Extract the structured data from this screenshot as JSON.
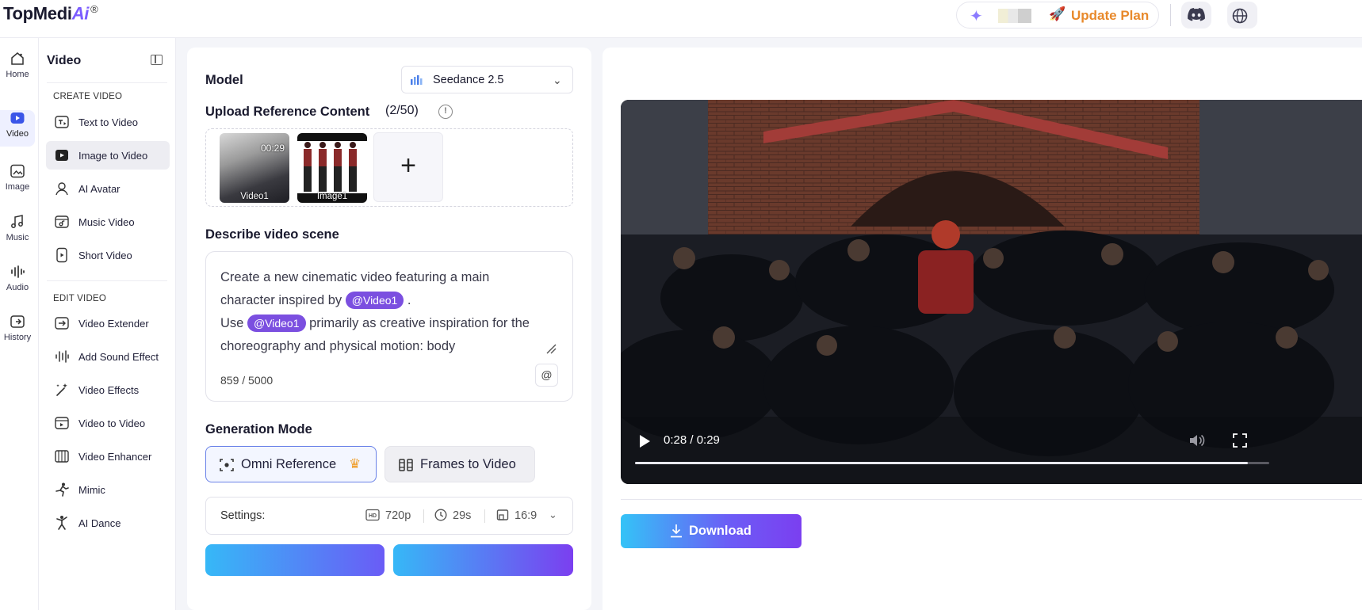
{
  "brand": {
    "name_main": "TopMedi",
    "name_ai": "Ai",
    "mark": "®"
  },
  "header": {
    "update_plan": "Update Plan"
  },
  "rail": [
    {
      "label": "Home",
      "icon": "home-icon"
    },
    {
      "label": "Video",
      "icon": "video-icon",
      "active": true
    },
    {
      "label": "Image",
      "icon": "image-icon"
    },
    {
      "label": "Music",
      "icon": "music-icon"
    },
    {
      "label": "Audio",
      "icon": "audio-icon"
    },
    {
      "label": "History",
      "icon": "history-icon"
    }
  ],
  "sidebar": {
    "title": "Video",
    "create_section": "CREATE VIDEO",
    "create_items": [
      {
        "label": "Text to Video",
        "icon": "text-to-video-icon"
      },
      {
        "label": "Image to Video",
        "icon": "image-to-video-icon",
        "active": true
      },
      {
        "label": "AI Avatar",
        "icon": "avatar-icon"
      },
      {
        "label": "Music Video",
        "icon": "music-video-icon"
      },
      {
        "label": "Short Video",
        "icon": "short-video-icon"
      }
    ],
    "edit_section": "EDIT VIDEO",
    "edit_items": [
      {
        "label": "Video Extender",
        "icon": "video-extender-icon"
      },
      {
        "label": "Add Sound Effect",
        "icon": "sound-effect-icon"
      },
      {
        "label": "Video Effects",
        "icon": "magic-wand-icon"
      },
      {
        "label": "Video to Video",
        "icon": "video-to-video-icon"
      },
      {
        "label": "Video Enhancer",
        "icon": "enhancer-icon"
      },
      {
        "label": "Mimic",
        "icon": "mimic-icon"
      },
      {
        "label": "AI Dance",
        "icon": "dance-icon"
      }
    ]
  },
  "form": {
    "model_label": "Model",
    "model_value": "Seedance 2.5",
    "upload_label": "Upload Reference Content",
    "upload_count": "(2/50)",
    "uploads": [
      {
        "tag": "Video1",
        "duration": "00:29"
      },
      {
        "tag": "Image1"
      }
    ],
    "describe_label": "Describe video scene",
    "prompt": {
      "line1": "Create a new cinematic video featuring a main",
      "line2_pre": "character inspired by",
      "chip1": "@Video1",
      "line2_post": ".",
      "line3_pre": "Use",
      "chip2": "@Video1",
      "line3_post": "primarily as creative inspiration for the",
      "line4": "choreography and physical motion: body"
    },
    "char_count": "859 / 5000",
    "at_symbol": "@",
    "generation_mode_label": "Generation Mode",
    "modes": [
      {
        "label": "Omni Reference",
        "selected": true
      },
      {
        "label": "Frames to Video"
      }
    ],
    "settings_label": "Settings:",
    "settings": {
      "resolution": "720p",
      "duration": "29s",
      "aspect": "16:9"
    }
  },
  "player": {
    "time": "0:28 / 0:29",
    "progress": 0.966,
    "download": "Download"
  },
  "colors": {
    "accent": "#7b4fe0",
    "update_plan": "#e8892b",
    "selection_border": "#6a82e8"
  }
}
